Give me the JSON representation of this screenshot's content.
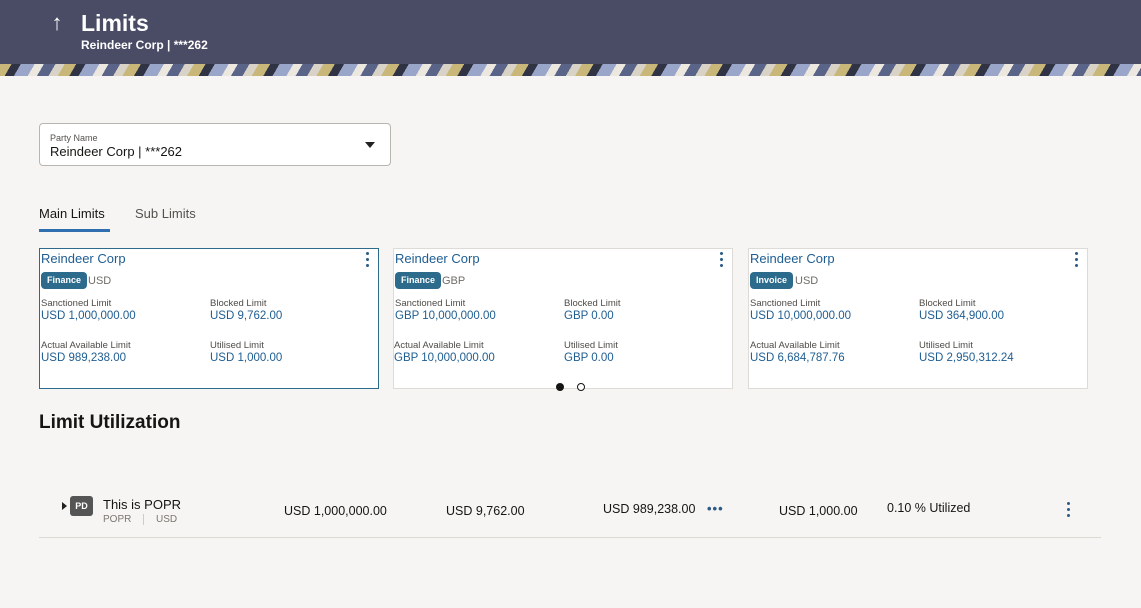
{
  "header": {
    "title": "Limits",
    "subtitle": "Reindeer Corp | ***262",
    "back_icon": "↑"
  },
  "party": {
    "label": "Party Name",
    "value": "Reindeer Corp | ***262"
  },
  "tabs": [
    {
      "label": "Main Limits",
      "active": true
    },
    {
      "label": "Sub Limits",
      "active": false
    }
  ],
  "cards": [
    {
      "title": "Reindeer Corp",
      "badge": "Finance",
      "currency": "USD",
      "sanctioned_label": "Sanctioned Limit",
      "sanctioned_value": "USD 1,000,000.00",
      "blocked_label": "Blocked Limit",
      "blocked_value": "USD 9,762.00",
      "available_label": "Actual Available Limit",
      "available_value": "USD 989,238.00",
      "utilised_label": "Utilised Limit",
      "utilised_value": "USD 1,000.00"
    },
    {
      "title": "Reindeer Corp",
      "badge": "Finance",
      "currency": "GBP",
      "sanctioned_label": "Sanctioned Limit",
      "sanctioned_value": "GBP 10,000,000.00",
      "blocked_label": "Blocked Limit",
      "blocked_value": "GBP 0.00",
      "available_label": "Actual Available Limit",
      "available_value": "GBP 10,000,000.00",
      "utilised_label": "Utilised Limit",
      "utilised_value": "GBP 0.00"
    },
    {
      "title": "Reindeer Corp",
      "badge": "Invoice",
      "currency": "USD",
      "sanctioned_label": "Sanctioned Limit",
      "sanctioned_value": "USD 10,000,000.00",
      "blocked_label": "Blocked Limit",
      "blocked_value": "USD 364,900.00",
      "available_label": "Actual Available Limit",
      "available_value": "USD 6,684,787.76",
      "utilised_label": "Utilised Limit",
      "utilised_value": "USD 2,950,312.24"
    }
  ],
  "carousel": {
    "current_page": 1,
    "pages": 2
  },
  "section": {
    "title": "Limit Utilization"
  },
  "utilization_row": {
    "avatar": "PD",
    "name": "This is POPR",
    "code": "POPR",
    "currency": "USD",
    "sanctioned": "USD 1,000,000.00",
    "blocked": "USD 9,762.00",
    "available": "USD 989,238.00",
    "more": "•••",
    "utilised": "USD 1,000.00",
    "utilized_text": "0.10 % Utilized"
  },
  "colors": {
    "header_bg": "#4a4c66",
    "link_blue": "#1e5d92",
    "badge_teal": "#2c6b8b",
    "tab_underline": "#2f6fb0"
  }
}
